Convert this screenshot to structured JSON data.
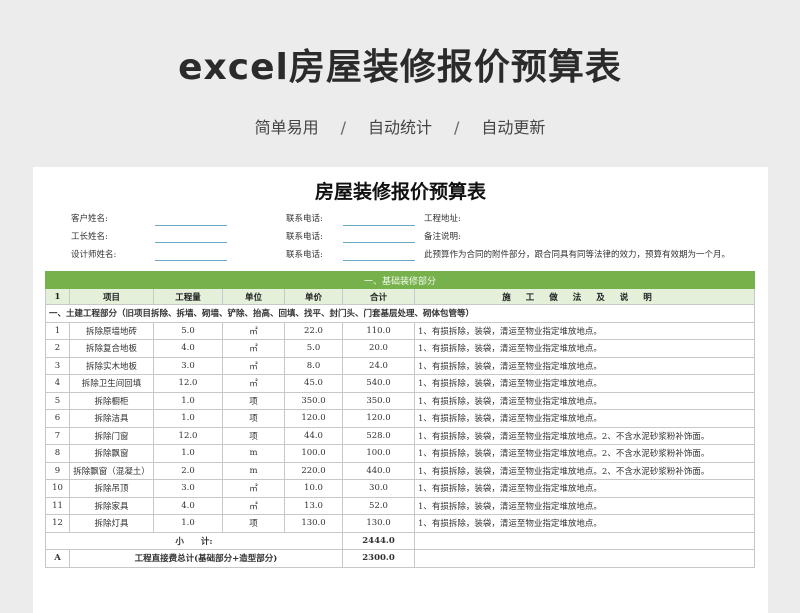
{
  "banner": {
    "title": "excel房屋装修报价预算表",
    "tags": [
      "简单易用",
      "自动统计",
      "自动更新"
    ],
    "separator": "/"
  },
  "sheet": {
    "title": "房屋装修报价预算表",
    "info": {
      "customer_name": "客户姓名:",
      "contact_phone_1": "联系电话:",
      "project_address": "工程地址:",
      "foreman_name": "工长姓名:",
      "contact_phone_2": "联系电话:",
      "remark": "备注说明:",
      "designer_name": "设计师姓名:",
      "contact_phone_3": "联系电话:",
      "notice": "此预算作为合同的附件部分，跟合同具有同等法律的效力，预算有效期为一个月。"
    },
    "section_header": "一、基础装修部分",
    "columns": {
      "no": "1",
      "item": "项目",
      "quantity": "工程量",
      "unit": "单位",
      "price": "单价",
      "total": "合计",
      "method": "施工做法及说明"
    },
    "subsection": "一、土建工程部分（旧项目拆除、拆墙、砌墙、铲除、抬高、回填、找平、封门头、门套基层处理、砌体包管等）",
    "rows": [
      {
        "no": "1",
        "item": "拆除原墙地砖",
        "quantity": "5.0",
        "unit": "㎡",
        "price": "22.0",
        "total": "110.0",
        "method": "1、有损拆除，装袋，清运至物业指定堆放地点。"
      },
      {
        "no": "2",
        "item": "拆除复合地板",
        "quantity": "4.0",
        "unit": "㎡",
        "price": "5.0",
        "total": "20.0",
        "method": "1、有损拆除，装袋，清运至物业指定堆放地点。"
      },
      {
        "no": "3",
        "item": "拆除实木地板",
        "quantity": "3.0",
        "unit": "㎡",
        "price": "8.0",
        "total": "24.0",
        "method": "1、有损拆除，装袋，清运至物业指定堆放地点。"
      },
      {
        "no": "4",
        "item": "拆除卫生间回填",
        "quantity": "12.0",
        "unit": "㎡",
        "price": "45.0",
        "total": "540.0",
        "method": "1、有损拆除，装袋，清运至物业指定堆放地点。"
      },
      {
        "no": "5",
        "item": "拆除橱柜",
        "quantity": "1.0",
        "unit": "项",
        "price": "350.0",
        "total": "350.0",
        "method": "1、有损拆除，装袋，清运至物业指定堆放地点。"
      },
      {
        "no": "6",
        "item": "拆除洁具",
        "quantity": "1.0",
        "unit": "项",
        "price": "120.0",
        "total": "120.0",
        "method": "1、有损拆除，装袋，清运至物业指定堆放地点。"
      },
      {
        "no": "7",
        "item": "拆除门窗",
        "quantity": "12.0",
        "unit": "项",
        "price": "44.0",
        "total": "528.0",
        "method": "1、有损拆除，装袋，清运至物业指定堆放地点。2、不含水泥砂浆粉补饰面。"
      },
      {
        "no": "8",
        "item": "拆除飘窗",
        "quantity": "1.0",
        "unit": "m",
        "price": "100.0",
        "total": "100.0",
        "method": "1、有损拆除，装袋，清运至物业指定堆放地点。2、不含水泥砂浆粉补饰面。"
      },
      {
        "no": "9",
        "item": "拆除飘窗（混凝土）",
        "quantity": "2.0",
        "unit": "m",
        "price": "220.0",
        "total": "440.0",
        "method": "1、有损拆除，装袋，清运至物业指定堆放地点。2、不含水泥砂浆粉补饰面。"
      },
      {
        "no": "10",
        "item": "拆除吊顶",
        "quantity": "3.0",
        "unit": "㎡",
        "price": "10.0",
        "total": "30.0",
        "method": "1、有损拆除，装袋，清运至物业指定堆放地点。"
      },
      {
        "no": "11",
        "item": "拆除家具",
        "quantity": "4.0",
        "unit": "㎡",
        "price": "13.0",
        "total": "52.0",
        "method": "1、有损拆除，装袋，清运至物业指定堆放地点。"
      },
      {
        "no": "12",
        "item": "拆除灯具",
        "quantity": "1.0",
        "unit": "项",
        "price": "130.0",
        "total": "130.0",
        "method": "1、有损拆除，装袋，清运至物业指定堆放地点。"
      }
    ],
    "subtotal": {
      "label": "小　　计:",
      "value": "2444.0"
    },
    "direct_cost": {
      "no": "A",
      "label": "工程直接费总计(基础部分+造型部分)",
      "value": "2300.0"
    }
  }
}
